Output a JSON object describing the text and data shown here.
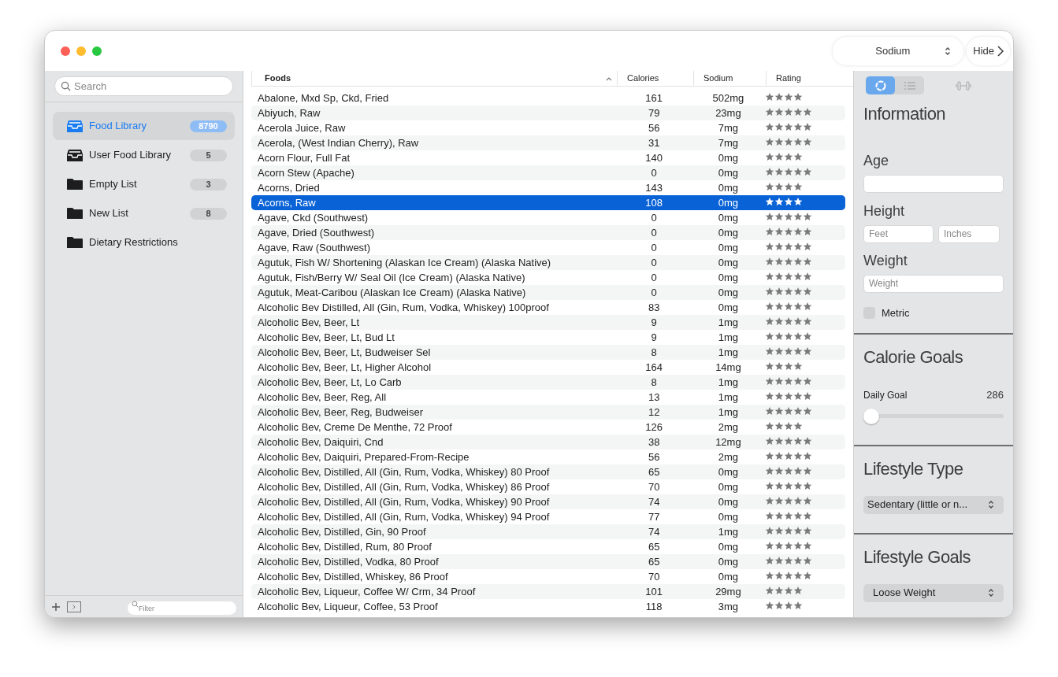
{
  "toolbar": {
    "nutrient_popup": "Sodium",
    "hide_button": "Hide"
  },
  "sidebar": {
    "search": {
      "placeholder": "Search"
    },
    "items": [
      {
        "kind": "library",
        "label": "Food Library",
        "badge": "8790",
        "selected": true
      },
      {
        "kind": "library",
        "label": "User Food Library",
        "badge": "5",
        "selected": false
      },
      {
        "kind": "folder",
        "label": "Empty List",
        "badge": "3",
        "selected": false
      },
      {
        "kind": "folder",
        "label": "New List",
        "badge": "8",
        "selected": false
      },
      {
        "kind": "folder",
        "label": "Dietary Restrictions",
        "selected": false
      }
    ],
    "filter": {
      "placeholder": "Filter"
    }
  },
  "table": {
    "columns": [
      {
        "label": "Foods",
        "sorted": true
      },
      {
        "label": "Calories",
        "sorted": false
      },
      {
        "label": "Sodium",
        "sorted": false
      },
      {
        "label": "Rating",
        "sorted": false
      }
    ],
    "rows": [
      {
        "food": "Abalone, Mxd Sp, Ckd, Fried",
        "calories": "161",
        "sodium": "502mg",
        "stars": 4,
        "selected": false
      },
      {
        "food": "Abiyuch, Raw",
        "calories": "79",
        "sodium": "23mg",
        "stars": 5,
        "selected": false
      },
      {
        "food": "Acerola Juice, Raw",
        "calories": "56",
        "sodium": "7mg",
        "stars": 5,
        "selected": false
      },
      {
        "food": "Acerola, (West Indian Cherry), Raw",
        "calories": "31",
        "sodium": "7mg",
        "stars": 5,
        "selected": false
      },
      {
        "food": "Acorn Flour, Full Fat",
        "calories": "140",
        "sodium": "0mg",
        "stars": 4,
        "selected": false
      },
      {
        "food": "Acorn Stew (Apache)",
        "calories": "0",
        "sodium": "0mg",
        "stars": 5,
        "selected": false
      },
      {
        "food": "Acorns, Dried",
        "calories": "143",
        "sodium": "0mg",
        "stars": 4,
        "selected": false
      },
      {
        "food": "Acorns, Raw",
        "calories": "108",
        "sodium": "0mg",
        "stars": 4,
        "selected": true
      },
      {
        "food": "Agave, Ckd (Southwest)",
        "calories": "0",
        "sodium": "0mg",
        "stars": 5,
        "selected": false
      },
      {
        "food": "Agave, Dried (Southwest)",
        "calories": "0",
        "sodium": "0mg",
        "stars": 5,
        "selected": false
      },
      {
        "food": "Agave, Raw (Southwest)",
        "calories": "0",
        "sodium": "0mg",
        "stars": 5,
        "selected": false
      },
      {
        "food": "Agutuk, Fish W/ Shortening (Alaskan Ice Cream) (Alaska Native)",
        "calories": "0",
        "sodium": "0mg",
        "stars": 5,
        "selected": false
      },
      {
        "food": "Agutuk, Fish/Berry W/ Seal Oil (Ice Cream) (Alaska Native)",
        "calories": "0",
        "sodium": "0mg",
        "stars": 5,
        "selected": false
      },
      {
        "food": "Agutuk, Meat-Caribou (Alaskan Ice Cream) (Alaska Native)",
        "calories": "0",
        "sodium": "0mg",
        "stars": 5,
        "selected": false
      },
      {
        "food": "Alcoholic Bev Distilled, All (Gin, Rum, Vodka, Whiskey) 100proof",
        "calories": "83",
        "sodium": "0mg",
        "stars": 5,
        "selected": false
      },
      {
        "food": "Alcoholic Bev, Beer, Lt",
        "calories": "9",
        "sodium": "1mg",
        "stars": 5,
        "selected": false
      },
      {
        "food": "Alcoholic Bev, Beer, Lt, Bud Lt",
        "calories": "9",
        "sodium": "1mg",
        "stars": 5,
        "selected": false
      },
      {
        "food": "Alcoholic Bev, Beer, Lt, Budweiser Sel",
        "calories": "8",
        "sodium": "1mg",
        "stars": 5,
        "selected": false
      },
      {
        "food": "Alcoholic Bev, Beer, Lt, Higher Alcohol",
        "calories": "164",
        "sodium": "14mg",
        "stars": 4,
        "selected": false
      },
      {
        "food": "Alcoholic Bev, Beer, Lt, Lo Carb",
        "calories": "8",
        "sodium": "1mg",
        "stars": 5,
        "selected": false
      },
      {
        "food": "Alcoholic Bev, Beer, Reg, All",
        "calories": "13",
        "sodium": "1mg",
        "stars": 5,
        "selected": false
      },
      {
        "food": "Alcoholic Bev, Beer, Reg, Budweiser",
        "calories": "12",
        "sodium": "1mg",
        "stars": 5,
        "selected": false
      },
      {
        "food": "Alcoholic Bev, Creme De Menthe, 72 Proof",
        "calories": "126",
        "sodium": "2mg",
        "stars": 4,
        "selected": false
      },
      {
        "food": "Alcoholic Bev, Daiquiri, Cnd",
        "calories": "38",
        "sodium": "12mg",
        "stars": 5,
        "selected": false
      },
      {
        "food": "Alcoholic Bev, Daiquiri, Prepared-From-Recipe",
        "calories": "56",
        "sodium": "2mg",
        "stars": 5,
        "selected": false
      },
      {
        "food": "Alcoholic Bev, Distilled, All (Gin, Rum, Vodka, Whiskey) 80 Proof",
        "calories": "65",
        "sodium": "0mg",
        "stars": 5,
        "selected": false
      },
      {
        "food": "Alcoholic Bev, Distilled, All (Gin, Rum, Vodka, Whiskey) 86 Proof",
        "calories": "70",
        "sodium": "0mg",
        "stars": 5,
        "selected": false
      },
      {
        "food": "Alcoholic Bev, Distilled, All (Gin, Rum, Vodka, Whiskey) 90 Proof",
        "calories": "74",
        "sodium": "0mg",
        "stars": 5,
        "selected": false
      },
      {
        "food": "Alcoholic Bev, Distilled, All (Gin, Rum, Vodka, Whiskey) 94 Proof",
        "calories": "77",
        "sodium": "0mg",
        "stars": 5,
        "selected": false
      },
      {
        "food": "Alcoholic Bev, Distilled, Gin, 90 Proof",
        "calories": "74",
        "sodium": "1mg",
        "stars": 5,
        "selected": false
      },
      {
        "food": "Alcoholic Bev, Distilled, Rum, 80 Proof",
        "calories": "65",
        "sodium": "0mg",
        "stars": 5,
        "selected": false
      },
      {
        "food": "Alcoholic Bev, Distilled, Vodka, 80 Proof",
        "calories": "65",
        "sodium": "0mg",
        "stars": 5,
        "selected": false
      },
      {
        "food": "Alcoholic Bev, Distilled, Whiskey, 86 Proof",
        "calories": "70",
        "sodium": "0mg",
        "stars": 5,
        "selected": false
      },
      {
        "food": "Alcoholic Bev, Liqueur, Coffee W/ Crm, 34 Proof",
        "calories": "101",
        "sodium": "29mg",
        "stars": 4,
        "selected": false
      },
      {
        "food": "Alcoholic Bev, Liqueur, Coffee, 53 Proof",
        "calories": "118",
        "sodium": "3mg",
        "stars": 4,
        "selected": false
      }
    ]
  },
  "inspector": {
    "view_tabs": [
      {
        "kind": "ring",
        "selected": true
      },
      {
        "kind": "list",
        "selected": false
      }
    ],
    "information": {
      "title": "Information",
      "age": {
        "label": "Age"
      },
      "height": {
        "label": "Height",
        "feet_placeholder": "Feet",
        "inches_placeholder": "Inches"
      },
      "weight": {
        "label": "Weight",
        "placeholder": "Weight"
      },
      "metric": {
        "label": "Metric",
        "checked": false
      }
    },
    "calorie_goals": {
      "title": "Calorie Goals",
      "daily_goal_label": "Daily Goal",
      "daily_goal_value": "286",
      "level": 0
    },
    "lifestyle_type": {
      "title": "Lifestyle Type",
      "value": "Sedentary (little or n..."
    },
    "lifestyle_goals": {
      "title": "Lifestyle Goals",
      "value": "Loose Weight"
    }
  }
}
